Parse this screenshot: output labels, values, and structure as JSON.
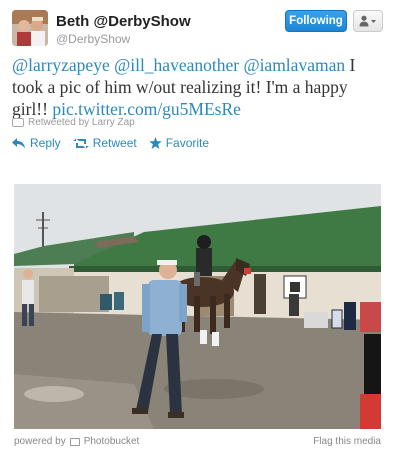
{
  "user": {
    "display_name": "Beth @DerbyShow",
    "screen_name": "@DerbyShow"
  },
  "buttons": {
    "following_label": "Following",
    "user_menu_icon": "person-dropdown-icon"
  },
  "tweet": {
    "mention_1": "@larryzapeye",
    "mention_2": "@ill_haveanother",
    "mention_3": "@iamlavaman",
    "text_1": " I took a pic of him w/out realizing it! I'm a happy girl!! ",
    "link": "pic.twitter.com/gu5MEsRe"
  },
  "retweet": {
    "icon": "retweet-icon",
    "label": "Retweeted by Larry Zap"
  },
  "actions": {
    "reply": "Reply",
    "retweet": "Retweet",
    "favorite": "Favorite"
  },
  "footer": {
    "powered_by": "powered by",
    "provider": "Photobucket",
    "flag": "Flag this media"
  },
  "colors": {
    "link": "#2a8abb",
    "follow_button": "#1c86d6",
    "roof_green": "#3f7a45"
  }
}
